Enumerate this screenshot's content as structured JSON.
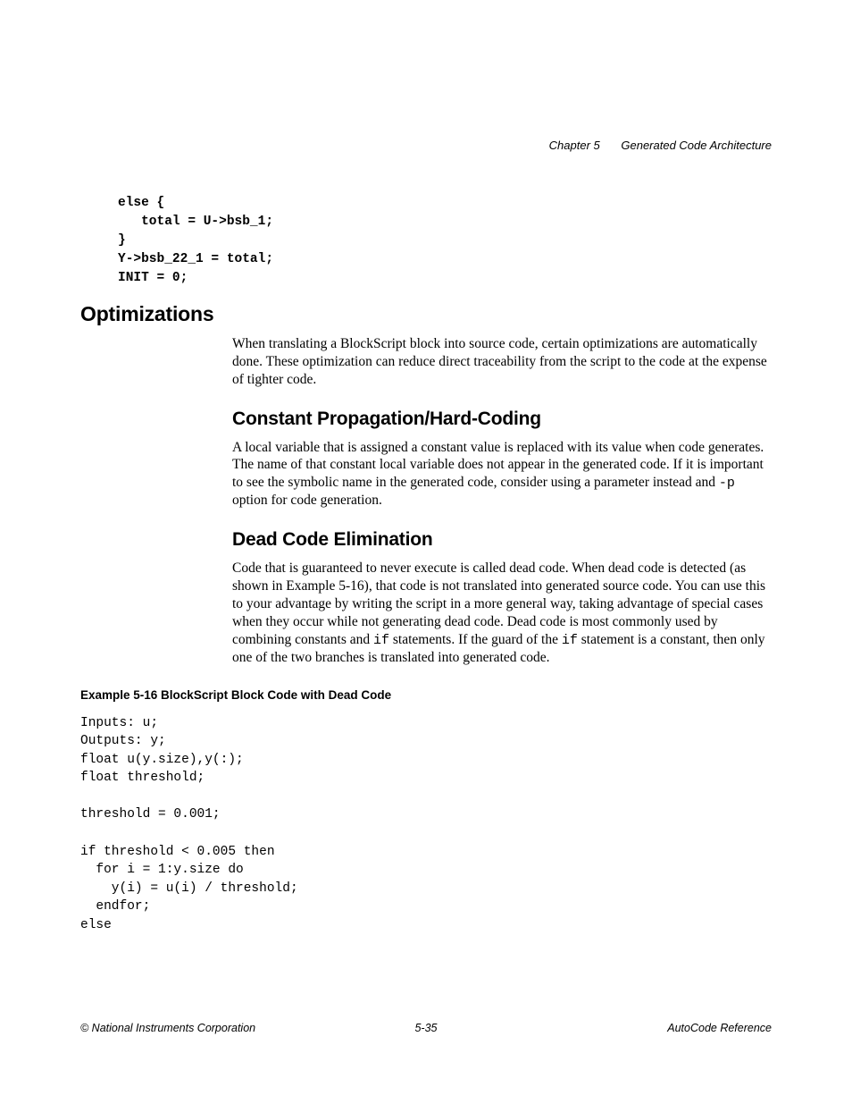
{
  "header": {
    "chapter": "Chapter 5",
    "title": "Generated Code Architecture"
  },
  "code_top": "else {\n   total = U->bsb_1;\n}\nY->bsb_22_1 = total;\nINIT = 0;",
  "h1": "Optimizations",
  "p1": "When translating a BlockScript block into source code, certain optimizations are automatically done. These optimization can reduce direct traceability from the script to the code at the expense of tighter code.",
  "h2a": "Constant Propagation/Hard-Coding",
  "p2a_part1": "A local variable that is assigned a constant value is replaced with its value when code generates. The name of that constant local variable does not appear in the generated code. If it is important to see the symbolic name in the generated code, consider using a parameter instead and ",
  "p2a_code": "-p",
  "p2a_part2": " option for code generation.",
  "h2b": "Dead Code Elimination",
  "p2b_part1": "Code that is guaranteed to never execute is called dead code. When dead code is detected (as shown in Example 5-16), that code is not translated into generated source code. You can use this to your advantage by writing the script in a more general way, taking advantage of special cases when they occur while not generating dead code. Dead code is most commonly used by combining constants and ",
  "p2b_code1": "if",
  "p2b_part2": " statements. If the guard of the ",
  "p2b_code2": "if",
  "p2b_part3": " statement is a constant, then only one of the two branches is translated into generated code.",
  "example_caption": "Example 5-16    BlockScript Block Code with Dead Code",
  "code_bottom": "Inputs: u;\nOutputs: y;\nfloat u(y.size),y(:);\nfloat threshold;\n\nthreshold = 0.001;\n\nif threshold < 0.005 then\n  for i = 1:y.size do\n    y(i) = u(i) / threshold;\n  endfor;\nelse",
  "footer": {
    "left": "© National Instruments Corporation",
    "center": "5-35",
    "right": "AutoCode Reference"
  }
}
